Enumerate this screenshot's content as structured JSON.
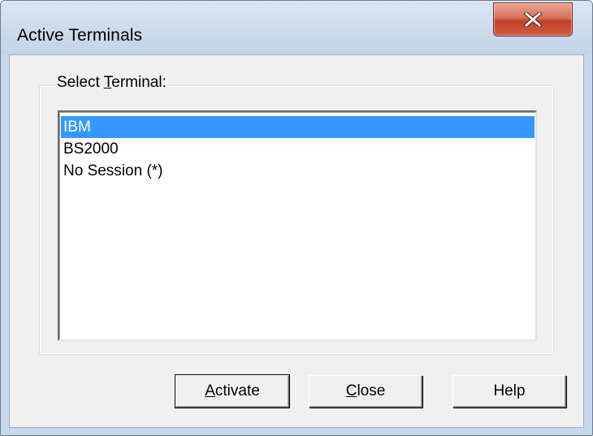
{
  "window": {
    "title": "Active Terminals",
    "close_icon": "close-x-icon"
  },
  "group": {
    "label_prefix": "Select ",
    "label_mnemonic": "T",
    "label_suffix": "erminal:"
  },
  "terminals": {
    "items": [
      "IBM",
      "BS2000",
      "No Session (*)"
    ],
    "selected_index": 0
  },
  "buttons": {
    "activate": {
      "mnemonic": "A",
      "rest": "ctivate"
    },
    "close": {
      "mnemonic": "C",
      "rest": "lose"
    },
    "help": {
      "label": "Help"
    }
  },
  "colors": {
    "selection": "#3399ff",
    "dialog_bg": "#f0f0f0",
    "close_button": "#c7442c"
  }
}
